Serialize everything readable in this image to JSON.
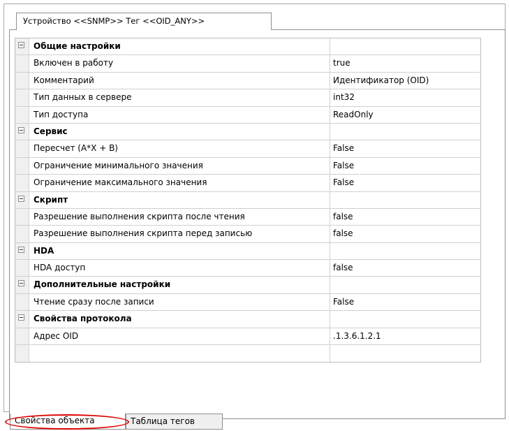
{
  "top_tab": {
    "label": "Устройство <<SNMP>> Тег <<OID_ANY>>"
  },
  "property_grid": {
    "rows": [
      {
        "kind": "category",
        "name": "Общие настройки",
        "value": ""
      },
      {
        "kind": "property",
        "name": "Включен в работу",
        "value": "true"
      },
      {
        "kind": "property",
        "name": "Комментарий",
        "value": "Идентификатор (OID)"
      },
      {
        "kind": "property",
        "name": "Тип данных в сервере",
        "value": "int32"
      },
      {
        "kind": "property",
        "name": "Тип доступа",
        "value": "ReadOnly"
      },
      {
        "kind": "category",
        "name": "Сервис",
        "value": ""
      },
      {
        "kind": "property",
        "name": "Пересчет (A*X + B)",
        "value": "False"
      },
      {
        "kind": "property",
        "name": "Ограничение минимального значения",
        "value": "False"
      },
      {
        "kind": "property",
        "name": "Ограничение максимального значения",
        "value": "False"
      },
      {
        "kind": "category",
        "name": "Скрипт",
        "value": ""
      },
      {
        "kind": "property",
        "name": "Разрешение выполнения скрипта после чтения",
        "value": "false"
      },
      {
        "kind": "property",
        "name": "Разрешение выполнения скрипта перед записью",
        "value": "false"
      },
      {
        "kind": "category",
        "name": "HDA",
        "value": ""
      },
      {
        "kind": "property",
        "name": "HDA доступ",
        "value": "false"
      },
      {
        "kind": "category",
        "name": "Дополнительные настройки",
        "value": ""
      },
      {
        "kind": "property",
        "name": "Чтение сразу после записи",
        "value": "False"
      },
      {
        "kind": "category",
        "name": "Свойства протокола",
        "value": ""
      },
      {
        "kind": "property",
        "name": "Адрес OID",
        "value": ".1.3.6.1.2.1"
      },
      {
        "kind": "empty",
        "name": "",
        "value": ""
      }
    ]
  },
  "bottom_tabs": [
    {
      "label": "Свойства объекта",
      "active": true
    },
    {
      "label": "Таблица тегов",
      "active": false
    }
  ],
  "colors": {
    "highlight": "#e00000",
    "grid_line": "#d0d0d0",
    "gutter": "#f0f0f0"
  },
  "icons": {
    "category_expander": "minus-box-icon"
  }
}
